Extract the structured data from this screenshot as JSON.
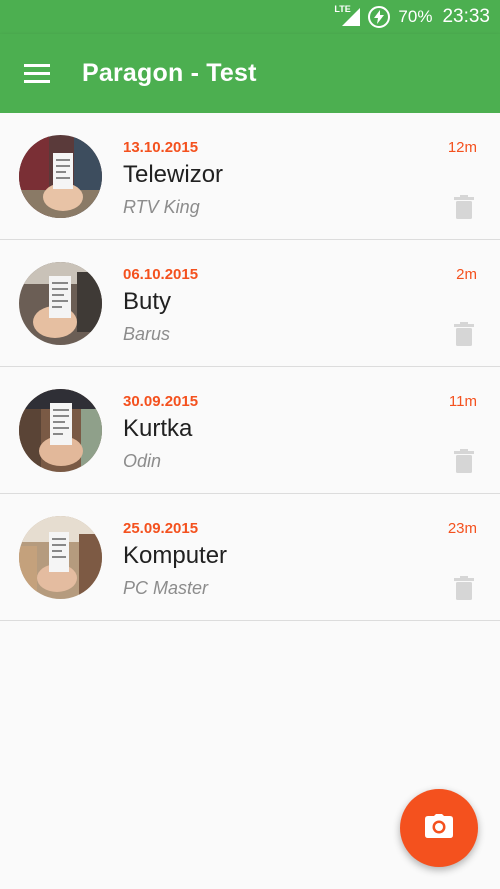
{
  "status_bar": {
    "network": "LTE",
    "battery": "70%",
    "time": "23:33"
  },
  "app_bar": {
    "menu_icon": "hamburger-menu-icon",
    "title": "Paragon - Test"
  },
  "receipts": [
    {
      "date": "13.10.2015",
      "age": "12m",
      "name": "Telewizor",
      "store": "RTV King"
    },
    {
      "date": "06.10.2015",
      "age": "2m",
      "name": "Buty",
      "store": "Barus"
    },
    {
      "date": "30.09.2015",
      "age": "11m",
      "name": "Kurtka",
      "store": "Odin"
    },
    {
      "date": "25.09.2015",
      "age": "23m",
      "name": "Komputer",
      "store": "PC Master"
    }
  ],
  "fab": {
    "icon": "camera-icon"
  },
  "colors": {
    "primary": "#4caf50",
    "accent": "#f4511e",
    "background": "#fafafa",
    "divider": "#dcdcdc",
    "secondary_text": "#8c8c8c"
  }
}
